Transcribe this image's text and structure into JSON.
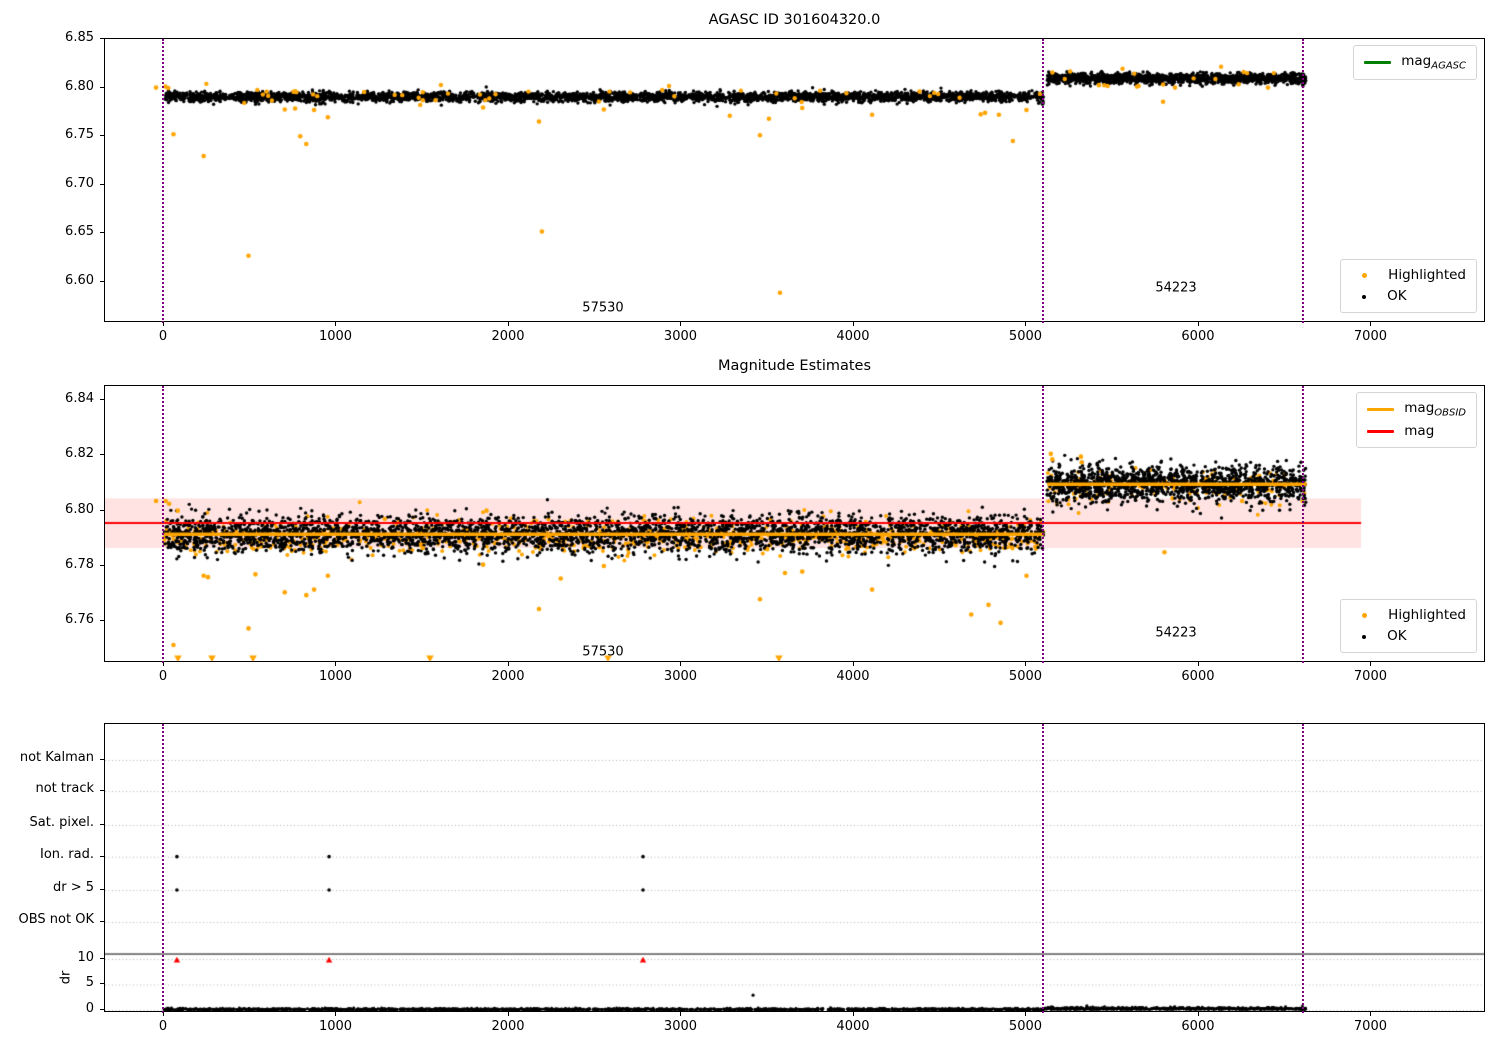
{
  "colors": {
    "highlighted": "#FFA500",
    "ok": "#000000",
    "mag_agasc_line": "#008000",
    "mag_obsid_line": "#FFA500",
    "mag_line": "#FF0000",
    "mag_band_fill": "rgba(255,0,0,0.11)",
    "obsid_divider": "#800080",
    "flag_triangle": "#FF0000",
    "grid": "#b5b5b5",
    "axis": "#000000"
  },
  "chart_data": [
    {
      "id": "mag-agasc",
      "type": "scatter",
      "title": "AGASC ID 301604320.0",
      "xlim": [
        -342,
        7664
      ],
      "ylim": [
        6.5578,
        6.85
      ],
      "xticks": [
        {
          "v": 0,
          "label": "0"
        },
        {
          "v": 1000,
          "label": "1000"
        },
        {
          "v": 2000,
          "label": "2000"
        },
        {
          "v": 3000,
          "label": "3000"
        },
        {
          "v": 4000,
          "label": "4000"
        },
        {
          "v": 5000,
          "label": "5000"
        },
        {
          "v": 6000,
          "label": "6000"
        },
        {
          "v": 7000,
          "label": "7000"
        }
      ],
      "yticks": [
        {
          "v": 6.85,
          "label": "6.85"
        },
        {
          "v": 6.8,
          "label": "6.80"
        },
        {
          "v": 6.75,
          "label": "6.75"
        },
        {
          "v": 6.7,
          "label": "6.70"
        },
        {
          "v": 6.65,
          "label": "6.65"
        },
        {
          "v": 6.6,
          "label": "6.60"
        }
      ],
      "vlines": [
        0,
        5101,
        6609
      ],
      "obsid_labels": [
        {
          "text": "57530",
          "x": 2545,
          "y": 6.573
        },
        {
          "text": "54223",
          "x": 5867,
          "y": 6.594
        }
      ],
      "legend_top": {
        "items": [
          {
            "label_main": "mag",
            "label_sub": "AGASC",
            "color_key": "mag_agasc_line",
            "type": "line"
          }
        ]
      },
      "legend_bottom": {
        "items": [
          {
            "label": "Highlighted",
            "color_key": "highlighted",
            "type": "dot"
          },
          {
            "label": "OK",
            "color_key": "ok",
            "type": "dot"
          }
        ]
      },
      "bands": [
        {
          "series": "OK",
          "color_key": "ok",
          "x0": 0,
          "x1": 5100,
          "n": 3300,
          "mean": 6.7905,
          "sd": 0.0026,
          "r": 1.7,
          "seed": 11
        },
        {
          "series": "OK",
          "color_key": "ok",
          "x0": 5120,
          "x1": 6620,
          "n": 1350,
          "mean": 6.8095,
          "sd": 0.0026,
          "r": 1.7,
          "seed": 12
        },
        {
          "series": "Highlighted",
          "color_key": "highlighted",
          "x0": 0,
          "x1": 5100,
          "n": 42,
          "mean": 6.791,
          "sd": 0.005,
          "r": 2.2,
          "seed": 13
        },
        {
          "series": "Highlighted",
          "color_key": "highlighted",
          "x0": 5120,
          "x1": 6620,
          "n": 13,
          "mean": 6.809,
          "sd": 0.0045,
          "r": 2.2,
          "seed": 14
        }
      ],
      "outliers_highlighted": [
        {
          "x": -46,
          "y": 6.8
        },
        {
          "x": 8,
          "y": 6.801
        },
        {
          "x": 25,
          "y": 6.7995
        },
        {
          "x": 55,
          "y": 6.752
        },
        {
          "x": 230,
          "y": 6.7295
        },
        {
          "x": 490,
          "y": 6.627
        },
        {
          "x": 700,
          "y": 6.7775
        },
        {
          "x": 760,
          "y": 6.7785
        },
        {
          "x": 790,
          "y": 6.75
        },
        {
          "x": 825,
          "y": 6.742
        },
        {
          "x": 870,
          "y": 6.777
        },
        {
          "x": 950,
          "y": 6.7695
        },
        {
          "x": 1160,
          "y": 6.7955
        },
        {
          "x": 1500,
          "y": 6.787
        },
        {
          "x": 1850,
          "y": 6.7795
        },
        {
          "x": 2174,
          "y": 6.765
        },
        {
          "x": 2191,
          "y": 6.652
        },
        {
          "x": 2550,
          "y": 6.7775
        },
        {
          "x": 3280,
          "y": 6.771
        },
        {
          "x": 3455,
          "y": 6.751
        },
        {
          "x": 3507,
          "y": 6.768
        },
        {
          "x": 3571,
          "y": 6.589
        },
        {
          "x": 3700,
          "y": 6.779
        },
        {
          "x": 4105,
          "y": 6.772
        },
        {
          "x": 4380,
          "y": 6.796
        },
        {
          "x": 4735,
          "y": 6.7725
        },
        {
          "x": 4760,
          "y": 6.774
        },
        {
          "x": 4840,
          "y": 6.772
        },
        {
          "x": 4921,
          "y": 6.745
        },
        {
          "x": 5000,
          "y": 6.777
        },
        {
          "x": 5150,
          "y": 6.8155
        },
        {
          "x": 5253,
          "y": 6.8165
        },
        {
          "x": 5420,
          "y": 6.8025
        },
        {
          "x": 5641,
          "y": 6.801
        },
        {
          "x": 5792,
          "y": 6.7855
        },
        {
          "x": 5861,
          "y": 6.8
        },
        {
          "x": 6230,
          "y": 6.8035
        },
        {
          "x": 6400,
          "y": 6.8
        }
      ]
    },
    {
      "id": "magnitude-estimates",
      "type": "scatter",
      "title": "Magnitude Estimates",
      "xlim": [
        -342,
        7664
      ],
      "ylim": [
        6.745,
        6.845
      ],
      "xticks": [
        {
          "v": 0,
          "label": "0"
        },
        {
          "v": 1000,
          "label": "1000"
        },
        {
          "v": 2000,
          "label": "2000"
        },
        {
          "v": 3000,
          "label": "3000"
        },
        {
          "v": 4000,
          "label": "4000"
        },
        {
          "v": 5000,
          "label": "5000"
        },
        {
          "v": 6000,
          "label": "6000"
        },
        {
          "v": 7000,
          "label": "7000"
        }
      ],
      "yticks": [
        {
          "v": 6.84,
          "label": "6.84"
        },
        {
          "v": 6.82,
          "label": "6.82"
        },
        {
          "v": 6.8,
          "label": "6.80"
        },
        {
          "v": 6.78,
          "label": "6.78"
        },
        {
          "v": 6.76,
          "label": "6.76"
        }
      ],
      "vlines": [
        0,
        5101,
        6609
      ],
      "obsid_labels": [
        {
          "text": "57530",
          "x": 2545,
          "y": 6.749
        },
        {
          "text": "54223",
          "x": 5867,
          "y": 6.7558
        }
      ],
      "legend_top": {
        "items": [
          {
            "label_main": "mag",
            "label_sub": "OBSID",
            "color_key": "mag_obsid_line",
            "type": "line"
          },
          {
            "label_main": "mag",
            "label_sub": "",
            "color_key": "mag_line",
            "type": "line"
          }
        ]
      },
      "legend_bottom": {
        "items": [
          {
            "label": "Highlighted",
            "color_key": "highlighted",
            "type": "dot"
          },
          {
            "label": "OK",
            "color_key": "ok",
            "type": "dot"
          }
        ]
      },
      "mag_band": {
        "y0": 6.7865,
        "y1": 6.8045,
        "x0": -342,
        "x1": 6940
      },
      "hlines": [
        {
          "y": 6.7955,
          "x0": -342,
          "x1": 6940,
          "color_key": "mag_line",
          "lw": 2
        },
        {
          "y": 6.7915,
          "x0": 0,
          "x1": 5100,
          "color_key": "mag_obsid_line",
          "lw": 3.5
        },
        {
          "y": 6.8095,
          "x0": 5120,
          "x1": 6620,
          "color_key": "mag_obsid_line",
          "lw": 3.5
        }
      ],
      "bands": [
        {
          "series": "Highlighted",
          "color_key": "highlighted",
          "x0": 0,
          "x1": 5100,
          "n": 800,
          "mean": 6.7905,
          "sd": 0.003,
          "r": 2.0,
          "seed": 21
        },
        {
          "series": "Highlighted",
          "color_key": "highlighted",
          "x0": 5120,
          "x1": 6620,
          "n": 160,
          "mean": 6.8085,
          "sd": 0.003,
          "r": 2.0,
          "seed": 22
        },
        {
          "series": "OK",
          "color_key": "ok",
          "x0": 0,
          "x1": 5100,
          "n": 3500,
          "mean": 6.7915,
          "sd": 0.0033,
          "r": 1.7,
          "seed": 23
        },
        {
          "series": "OK",
          "color_key": "ok",
          "x0": 5120,
          "x1": 6620,
          "n": 1400,
          "mean": 6.8095,
          "sd": 0.0033,
          "r": 1.7,
          "seed": 24
        }
      ],
      "outliers_highlighted": [
        {
          "x": -46,
          "y": 6.8035
        },
        {
          "x": 10,
          "y": 6.8035
        },
        {
          "x": 30,
          "y": 6.8025
        },
        {
          "x": 55,
          "y": 6.7515
        },
        {
          "x": 80,
          "y": 6.8
        },
        {
          "x": 230,
          "y": 6.7765
        },
        {
          "x": 255,
          "y": 6.776
        },
        {
          "x": 490,
          "y": 6.7575
        },
        {
          "x": 530,
          "y": 6.777
        },
        {
          "x": 700,
          "y": 6.7705
        },
        {
          "x": 825,
          "y": 6.7695
        },
        {
          "x": 870,
          "y": 6.7715
        },
        {
          "x": 950,
          "y": 6.7765
        },
        {
          "x": 1280,
          "y": 6.797
        },
        {
          "x": 1500,
          "y": 6.7865
        },
        {
          "x": 1850,
          "y": 6.7805
        },
        {
          "x": 1870,
          "y": 6.8
        },
        {
          "x": 2174,
          "y": 6.7645
        },
        {
          "x": 2300,
          "y": 6.7755
        },
        {
          "x": 2550,
          "y": 6.78
        },
        {
          "x": 3455,
          "y": 6.768
        },
        {
          "x": 3600,
          "y": 6.7775
        },
        {
          "x": 3700,
          "y": 6.778
        },
        {
          "x": 4105,
          "y": 6.7715
        },
        {
          "x": 4680,
          "y": 6.7625
        },
        {
          "x": 4780,
          "y": 6.766
        },
        {
          "x": 4850,
          "y": 6.7595
        },
        {
          "x": 5000,
          "y": 6.7765
        },
        {
          "x": 5141,
          "y": 6.8205
        },
        {
          "x": 5150,
          "y": 6.8185
        },
        {
          "x": 5316,
          "y": 6.8195
        },
        {
          "x": 5320,
          "y": 6.8175
        },
        {
          "x": 5800,
          "y": 6.785
        },
        {
          "x": 6250,
          "y": 6.8035
        }
      ],
      "clipped_below_x": [
        81,
        278,
        516,
        1542,
        2574,
        3565
      ]
    },
    {
      "id": "flags",
      "type": "scatter",
      "title": "",
      "xlim": [
        -342,
        7664
      ],
      "xticks": [
        {
          "v": 0,
          "label": "0"
        },
        {
          "v": 1000,
          "label": "1000"
        },
        {
          "v": 2000,
          "label": "2000"
        },
        {
          "v": 3000,
          "label": "3000"
        },
        {
          "v": 4000,
          "label": "4000"
        },
        {
          "v": 5000,
          "label": "5000"
        },
        {
          "v": 6000,
          "label": "6000"
        },
        {
          "v": 7000,
          "label": "7000"
        }
      ],
      "vlines": [
        0,
        5101,
        6609
      ],
      "categories": [
        {
          "label": "not Kalman",
          "frac": 0.1246
        },
        {
          "label": "not track",
          "frac": 0.2318
        },
        {
          "label": "Sat. pixel.",
          "frac": 0.3495
        },
        {
          "label": "Ion. rad.",
          "frac": 0.459
        },
        {
          "label": "dr > 5",
          "frac": 0.5744
        },
        {
          "label": "OBS not OK",
          "frac": 0.685
        }
      ],
      "separator_frac": 0.796,
      "dr_axis": {
        "label": "dr",
        "zero_frac": 0.9896,
        "unit_frac": 0.01766,
        "ticks": [
          {
            "v": 10,
            "label": "10"
          },
          {
            "v": 5,
            "label": "5"
          },
          {
            "v": 0,
            "label": "0"
          }
        ]
      },
      "flag_points": [
        {
          "x": 75,
          "row": 3
        },
        {
          "x": 75,
          "row": 4
        },
        {
          "x": 957,
          "row": 3
        },
        {
          "x": 957,
          "row": 4
        },
        {
          "x": 2777,
          "row": 3
        },
        {
          "x": 2777,
          "row": 4
        }
      ],
      "dr_flag_triangles": [
        {
          "x": 75,
          "dr": 9.8
        },
        {
          "x": 957,
          "dr": 9.8
        },
        {
          "x": 2777,
          "dr": 9.8
        }
      ],
      "dr_bands": [
        {
          "x0": 0,
          "x1": 5100,
          "n": 1900,
          "base": 0.03,
          "sd": 0.13,
          "seed": 31
        },
        {
          "x0": 5100,
          "x1": 6620,
          "n": 750,
          "base": 0.12,
          "sd": 0.18,
          "seed": 32
        }
      ],
      "dr_outliers": [
        {
          "x": 3415,
          "dr": 2.9
        },
        {
          "x": 5350,
          "dr": 0.8
        }
      ]
    }
  ]
}
